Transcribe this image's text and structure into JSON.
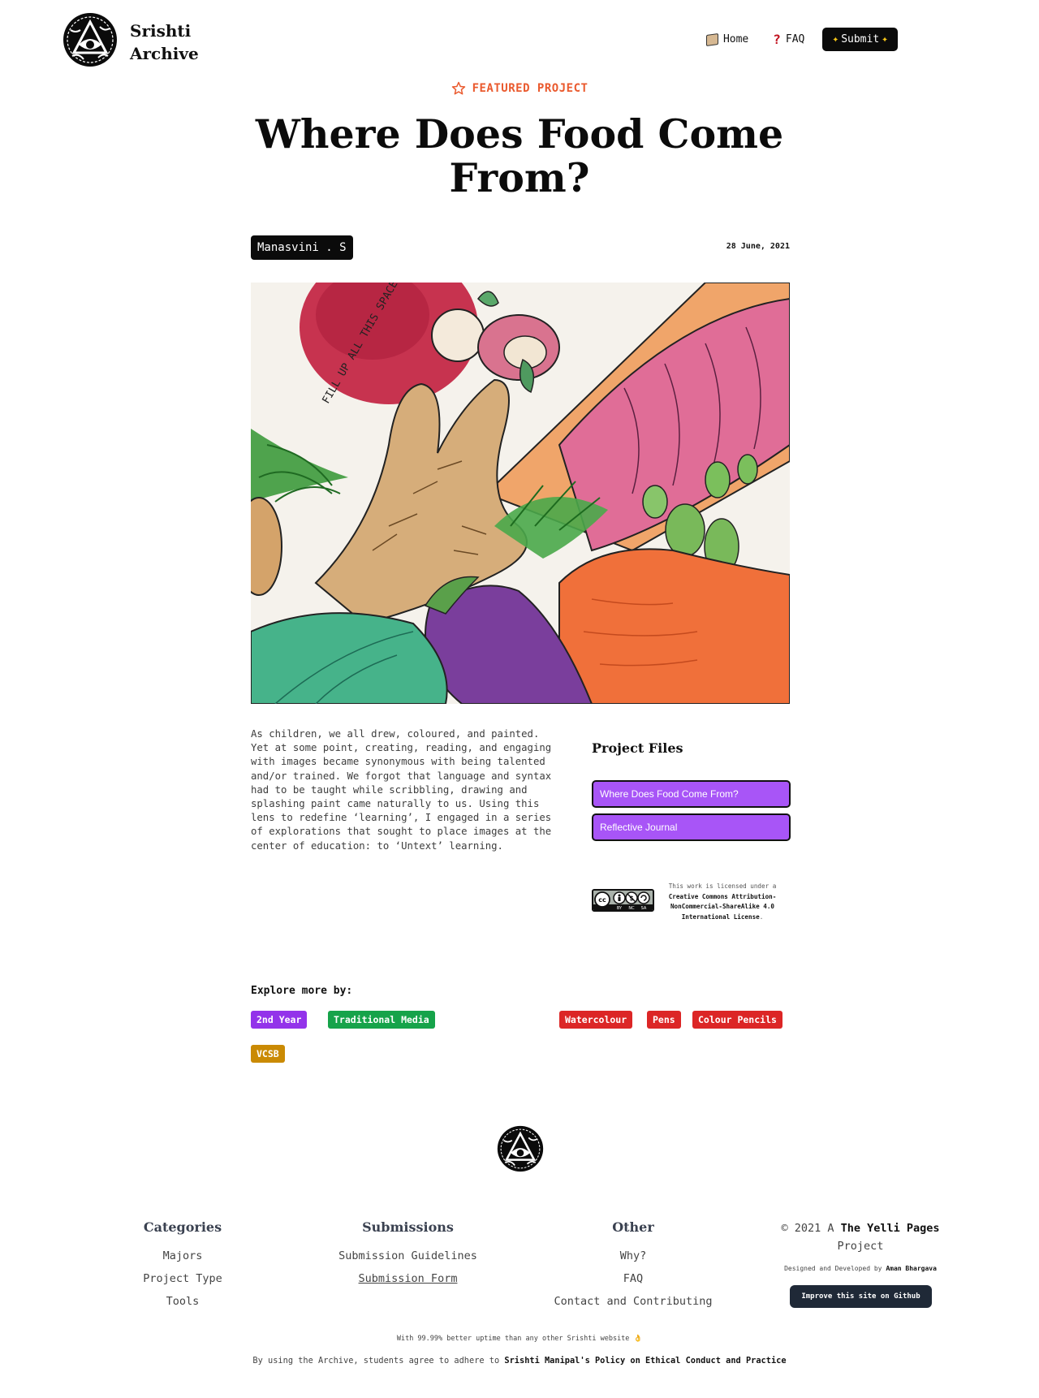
{
  "header": {
    "brand_line1": "Srishti",
    "brand_line2": "Archive",
    "nav": {
      "home": "Home",
      "faq": "FAQ",
      "submit": "Submit"
    }
  },
  "featured_label": "FEATURED PROJECT",
  "project": {
    "title": "Where Does Food Come From?",
    "author": "Manasvini . S",
    "date": "28 June, 2021",
    "description": "As children, we all drew, coloured, and painted. Yet at some point, creating, reading, and engaging with images became synonymous with being talented and/or trained. We forgot that language and syntax had to be taught while scribbling, drawing and splashing paint came naturally to us. Using this lens to redefine ‘learning’, I engaged in a series of explorations that sought to place images at the center of education: to ‘Untext’ learning.",
    "art_text": "FILL UP ALL THIS SPACE WITH SOS"
  },
  "files": {
    "title": "Project Files",
    "items": [
      "Where Does Food Come From?",
      "Reflective Journal"
    ]
  },
  "license": {
    "line1": "This work is licensed under a",
    "name": "Creative Commons Attribution-NonCommercial-ShareAlike 4.0 International License",
    "end": ".",
    "badge": {
      "cc": "cc",
      "by": "BY",
      "nc": "NC",
      "sa": "SA"
    }
  },
  "explore": {
    "title": "Explore more by:",
    "tags": [
      {
        "label": "2nd Year",
        "color": "#9333ea"
      },
      {
        "label": "Traditional Media",
        "color": "#16a34a"
      },
      {
        "label": "Watercolour",
        "color": "#dc2626"
      },
      {
        "label": "Pens",
        "color": "#dc2626"
      },
      {
        "label": "Colour Pencils",
        "color": "#dc2626"
      },
      {
        "label": "VCSB",
        "color": "#ca8a04"
      }
    ]
  },
  "footer": {
    "categories": {
      "title": "Categories",
      "links": [
        "Majors",
        "Project Type",
        "Tools"
      ]
    },
    "submissions": {
      "title": "Submissions",
      "links": [
        "Submission Guidelines",
        "Submission Form"
      ]
    },
    "other": {
      "title": "Other",
      "links": [
        "Why?",
        "FAQ",
        "Contact and Contributing"
      ]
    },
    "copyright_prefix": "© 2021 A",
    "copyright_name": "The Yelli Pages",
    "copyright_suffix": "Project",
    "designed_prefix": "Designed and Developed by",
    "designer": "Aman Bhargava",
    "github_button": "Improve this site on Github",
    "uptime": "With 99.99% better uptime than any other Srishti website",
    "uptime_emoji": "👌",
    "policy_prefix": "By using the Archive, students agree to adhere to",
    "policy_link": "Srishti Manipal's Policy on Ethical Conduct and Practice"
  }
}
